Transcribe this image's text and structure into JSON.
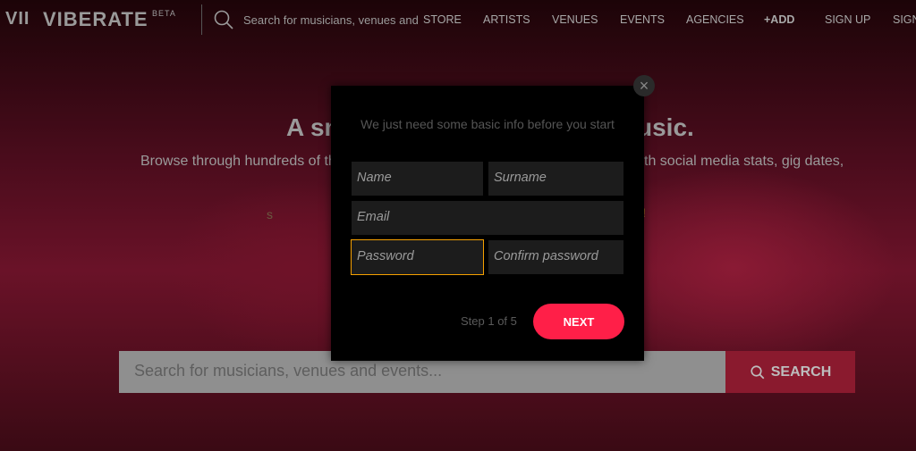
{
  "nav": {
    "logo_mark": "VII",
    "logo": "VIBERATE",
    "beta": "BETA",
    "search_placeholder": "Search for musicians, venues and",
    "items": [
      "STORE",
      "ARTISTS",
      "VENUES",
      "EVENTS",
      "AGENCIES",
      "+ADD",
      "SIGN UP",
      "SIGN"
    ]
  },
  "hero": {
    "headline_left": "A sm",
    "headline_right": "usic.",
    "sub_left": "Browse through hundreds of tho",
    "sub_right": "th social media stats, gig dates,",
    "fragment_left": "s",
    "fragment_right": "!",
    "search_placeholder": "Search for musicians, venues and events...",
    "search_button": "SEARCH"
  },
  "modal": {
    "intro": "We just need some basic info before you start",
    "fields": {
      "name": "Name",
      "surname": "Surname",
      "email": "Email",
      "password": "Password",
      "confirm": "Confirm password"
    },
    "step": "Step 1 of 5",
    "next": "NEXT",
    "close": "×"
  },
  "colors": {
    "accent": "#ff1f48",
    "focus": "#f5a000"
  }
}
